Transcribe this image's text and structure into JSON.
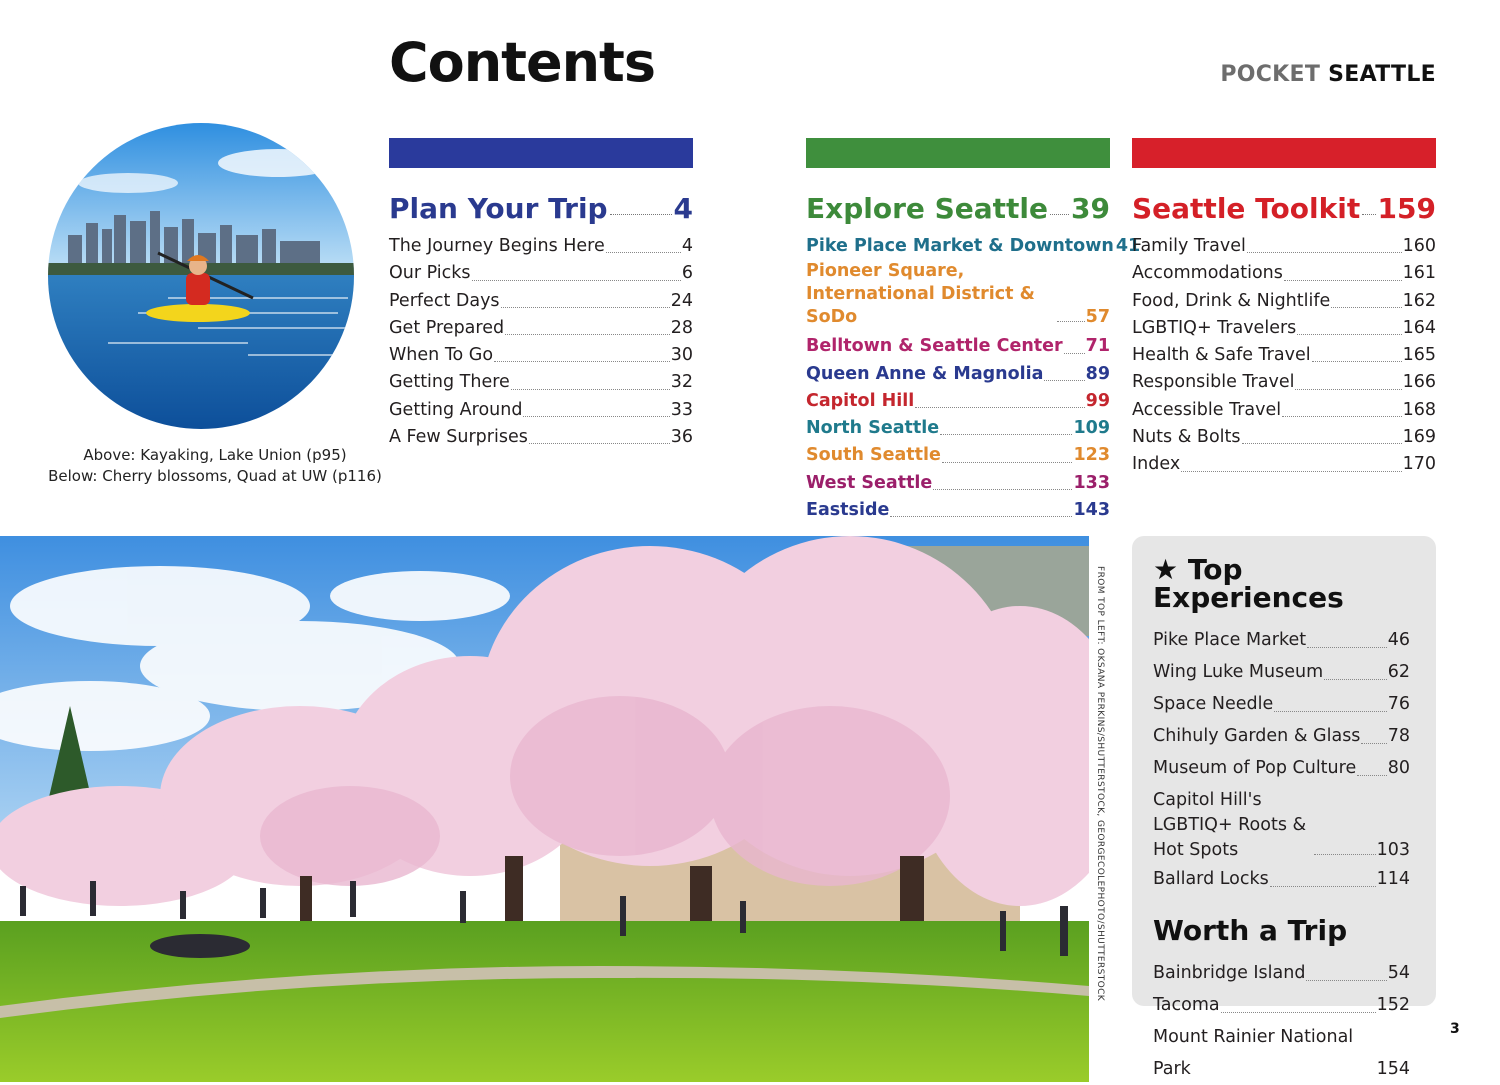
{
  "header": {
    "title": "Contents",
    "brand_light": "POCKET",
    "brand_bold": "SEATTLE"
  },
  "caption": {
    "above": "Above: Kayaking, Lake Union (p95)",
    "below": "Below: Cherry blossoms, Quad at UW (p116)"
  },
  "sections": [
    {
      "title": "Plan Your Trip",
      "page": "4",
      "color": "#2a3a8f",
      "bar_color": "#2a3a9c",
      "entries": [
        {
          "label": "The Journey Begins Here",
          "page": "4"
        },
        {
          "label": "Our Picks",
          "page": "6"
        },
        {
          "label": "Perfect Days",
          "page": "24"
        },
        {
          "label": "Get Prepared",
          "page": "28"
        },
        {
          "label": "When To Go",
          "page": "30"
        },
        {
          "label": "Getting There",
          "page": "32"
        },
        {
          "label": "Getting Around",
          "page": "33"
        },
        {
          "label": "A Few Surprises",
          "page": "36"
        }
      ]
    },
    {
      "title": "Explore Seattle",
      "page": "39",
      "color": "#3d8a3a",
      "bar_color": "#3f8f3d",
      "entries": [
        {
          "label": "Pike Place Market & Downtown",
          "page": "41",
          "color": "#1f6f8b"
        },
        {
          "label": "Pioneer Square, International District & SoDo",
          "page": "57",
          "color": "#e08a2e"
        },
        {
          "label": "Belltown & Seattle Center",
          "page": "71",
          "color": "#b0246b"
        },
        {
          "label": "Queen Anne & Magnolia",
          "page": "89",
          "color": "#2a3a8f"
        },
        {
          "label": "Capitol Hill",
          "page": "99",
          "color": "#c4262e"
        },
        {
          "label": "North Seattle",
          "page": "109",
          "color": "#1f7a8c"
        },
        {
          "label": "South Seattle",
          "page": "123",
          "color": "#e08a2e"
        },
        {
          "label": "West Seattle",
          "page": "133",
          "color": "#9b1f6a"
        },
        {
          "label": "Eastside",
          "page": "143",
          "color": "#2a3a8f"
        }
      ]
    },
    {
      "title": "Seattle Toolkit",
      "page": "159",
      "color": "#d42027",
      "bar_color": "#d7202a",
      "entries": [
        {
          "label": "Family Travel",
          "page": "160"
        },
        {
          "label": "Accommodations",
          "page": "161"
        },
        {
          "label": "Food, Drink & Nightlife",
          "page": "162"
        },
        {
          "label": "LGBTIQ+ Travelers",
          "page": "164"
        },
        {
          "label": "Health & Safe Travel",
          "page": "165"
        },
        {
          "label": "Responsible Travel",
          "page": "166"
        },
        {
          "label": "Accessible Travel",
          "page": "168"
        },
        {
          "label": "Nuts & Bolts",
          "page": "169"
        },
        {
          "label": "Index",
          "page": "170"
        }
      ]
    }
  ],
  "sidebar": {
    "top_title": "Top Experiences",
    "top_icon": "star-icon",
    "top": [
      {
        "label": "Pike Place Market",
        "page": "46"
      },
      {
        "label": "Wing Luke Museum",
        "page": "62"
      },
      {
        "label": "Space Needle",
        "page": "76"
      },
      {
        "label": "Chihuly Garden & Glass",
        "page": "78"
      },
      {
        "label": "Museum of Pop Culture",
        "page": "80"
      },
      {
        "label": "Capitol Hill's LGBTIQ+ Roots & Hot Spots",
        "page": "103"
      },
      {
        "label": "Ballard Locks",
        "page": "114"
      }
    ],
    "trip_title": "Worth a Trip",
    "trips": [
      {
        "label": "Bainbridge Island",
        "page": "54"
      },
      {
        "label": "Tacoma",
        "page": "152"
      },
      {
        "label": "Mount Rainier National Park",
        "page": "154"
      }
    ]
  },
  "credit": "FROM TOP LEFT: OKSANA PERKINS/SHUTTERSTOCK, GEORGECOLEPHOTO/SHUTTERSTOCK",
  "page_number": "3"
}
